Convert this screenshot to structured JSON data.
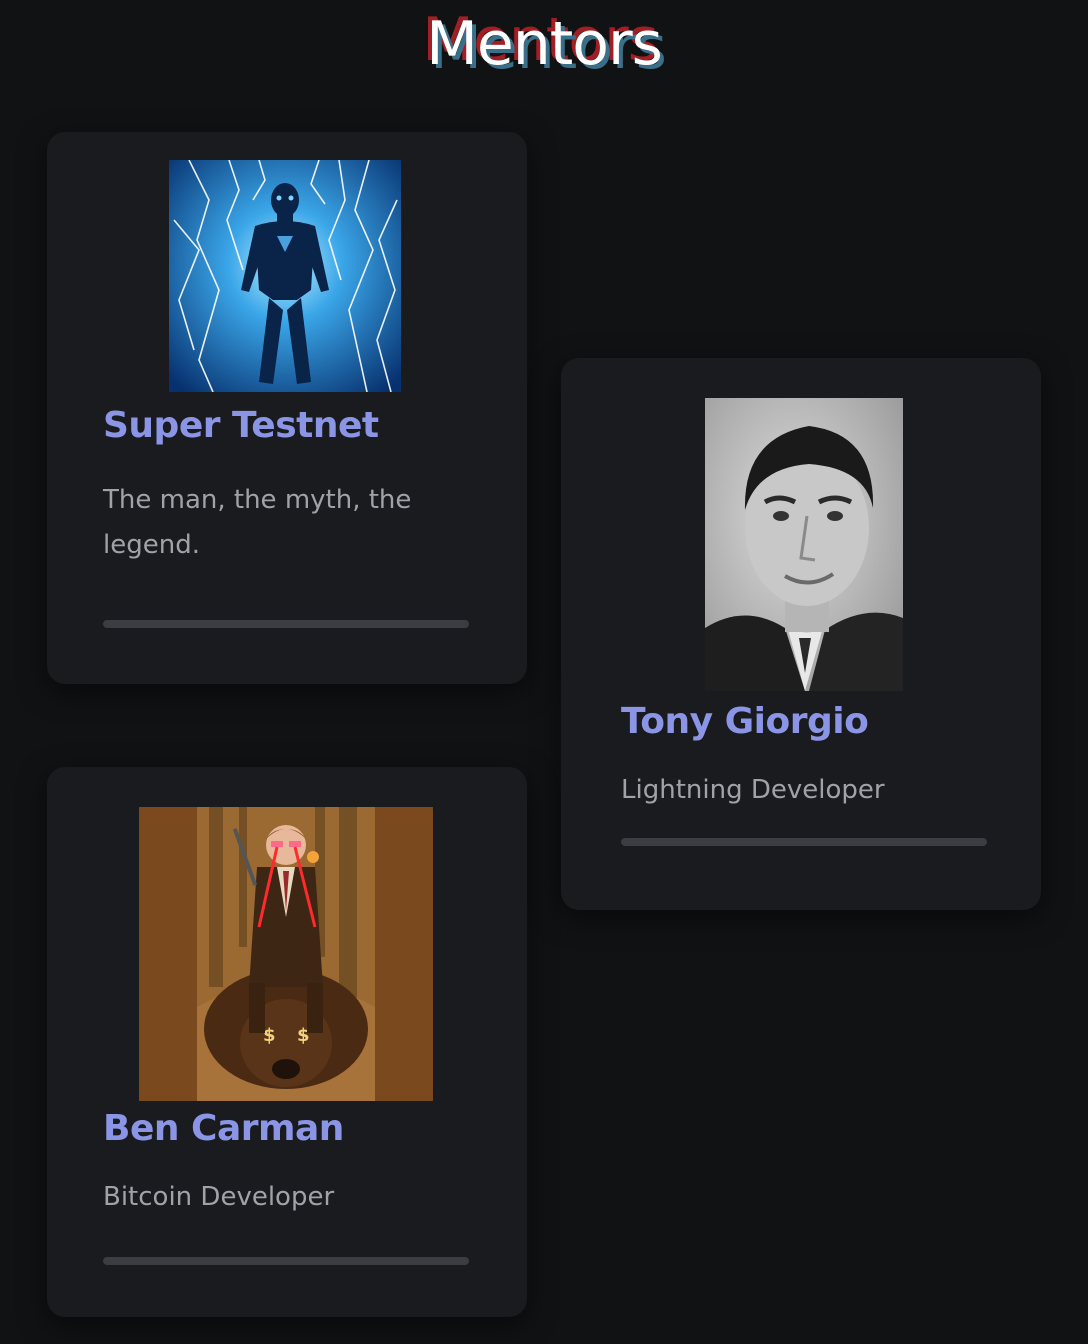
{
  "page": {
    "title": "Mentors"
  },
  "mentors": [
    {
      "name": "Super Testnet",
      "role": "The man, the myth, the legend.",
      "image": "superhero-lightning-portrait"
    },
    {
      "name": "Tony Giorgio",
      "role": "Lightning Developer",
      "image": "black-and-white-portrait"
    },
    {
      "name": "Ben Carman",
      "role": "Bitcoin Developer",
      "image": "man-riding-bear-illustration"
    }
  ],
  "colors": {
    "background": "#111214",
    "card": "#1a1b1e",
    "name": "#8b95e6",
    "role": "#a0a2a8",
    "bar": "#3c3d42"
  }
}
